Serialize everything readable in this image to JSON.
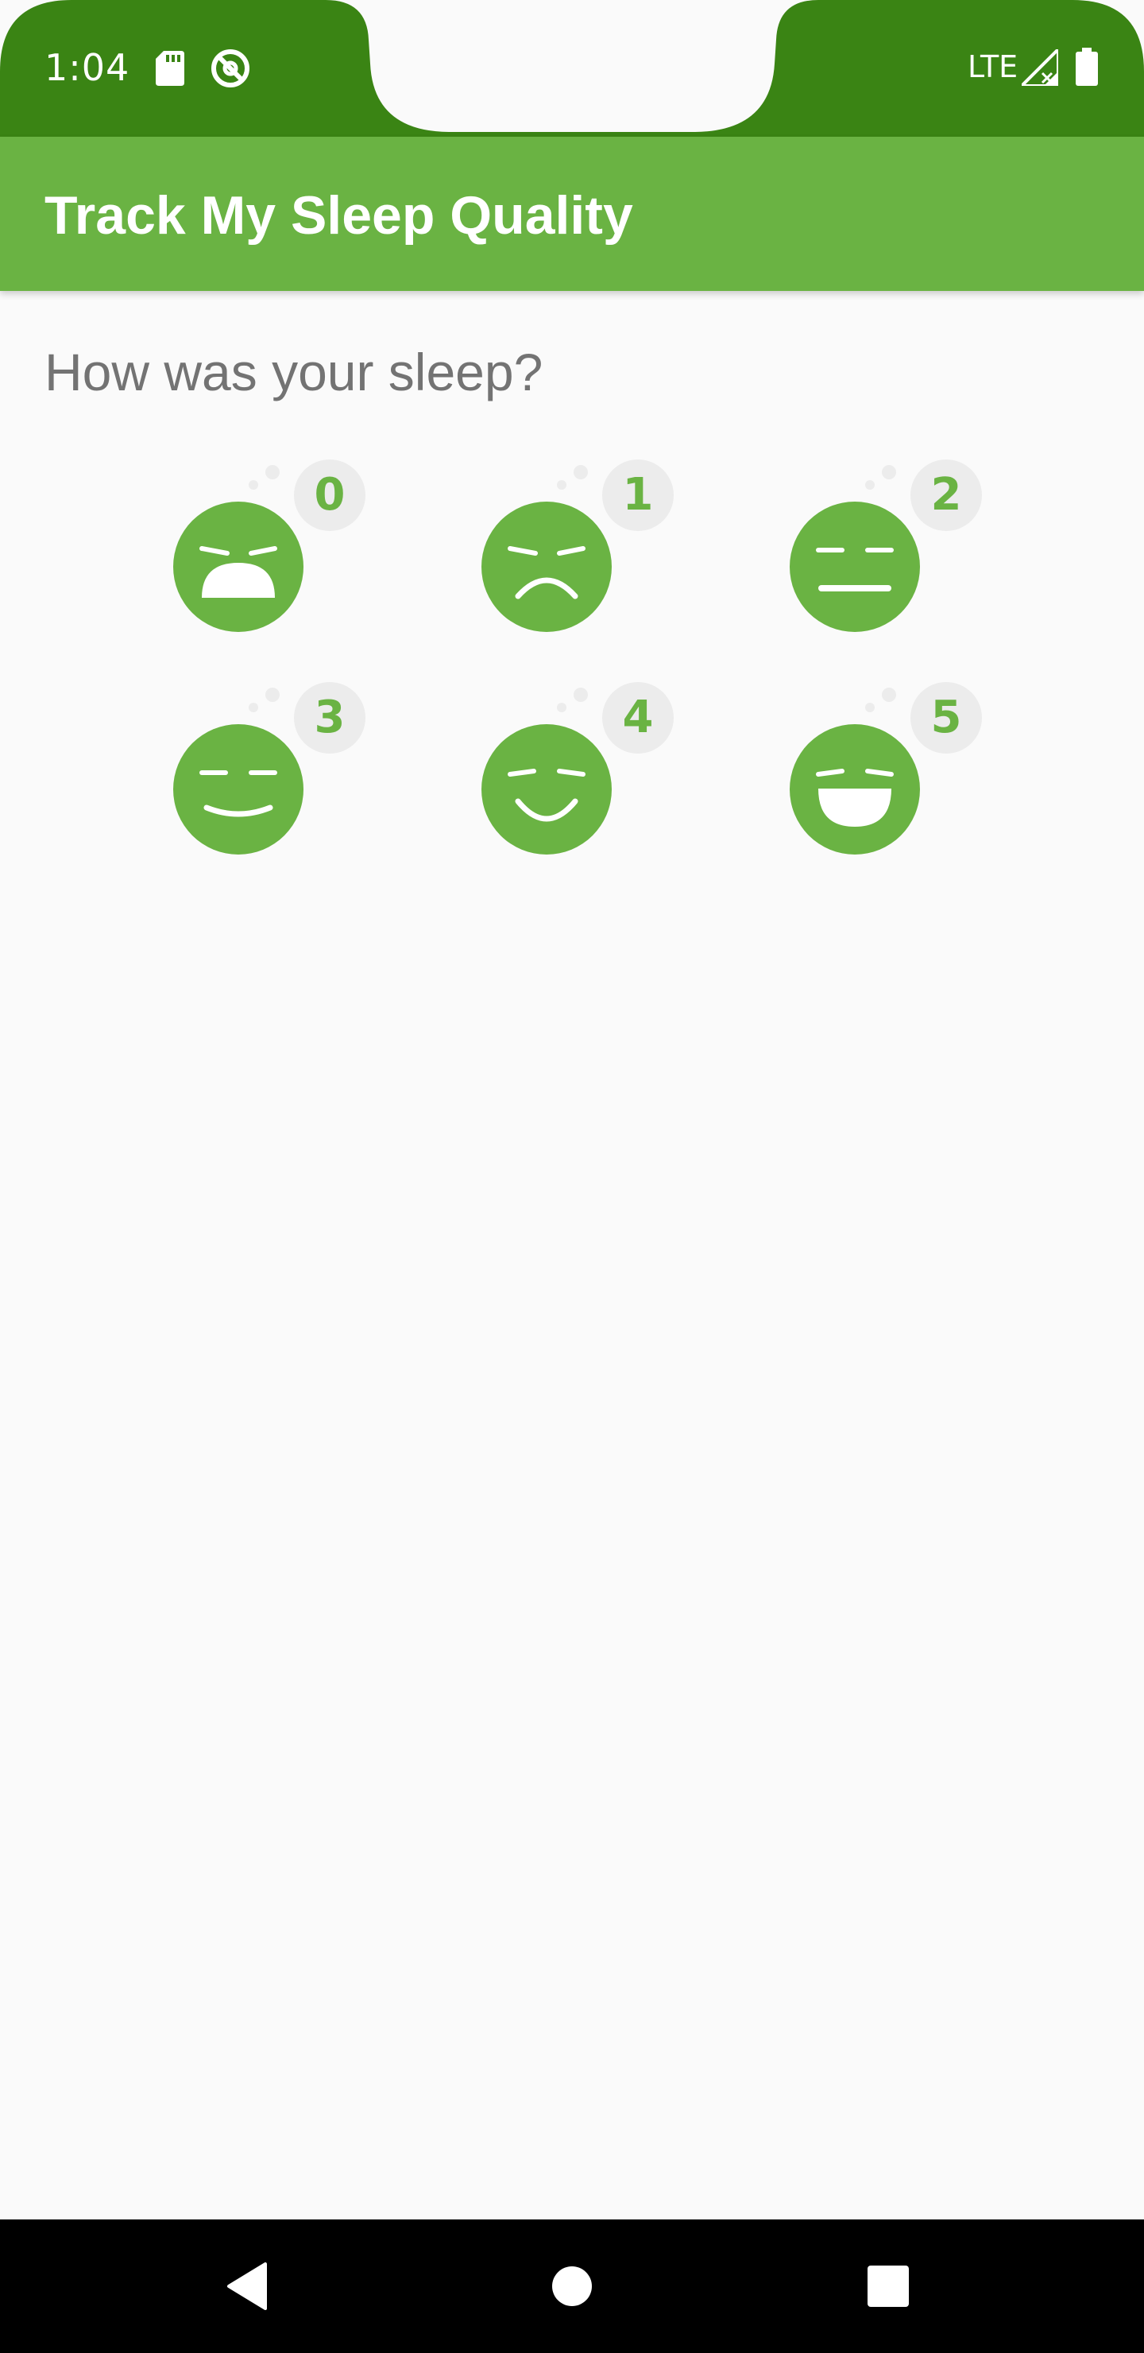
{
  "status_bar": {
    "time": "1:04",
    "network": "LTE",
    "icons": [
      "sd-card-icon",
      "do-not-disturb-icon",
      "signal-icon",
      "battery-icon"
    ],
    "color": "#3a8414"
  },
  "app_bar": {
    "title": "Track My Sleep Quality",
    "color": "#6ab343"
  },
  "content": {
    "prompt": "How was your sleep?",
    "quality_options": [
      {
        "value": "0",
        "icon": "very-bad-sleep-face-icon"
      },
      {
        "value": "1",
        "icon": "bad-sleep-face-icon"
      },
      {
        "value": "2",
        "icon": "neutral-sleep-face-icon"
      },
      {
        "value": "3",
        "icon": "okay-sleep-face-icon"
      },
      {
        "value": "4",
        "icon": "good-sleep-face-icon"
      },
      {
        "value": "5",
        "icon": "excellent-sleep-face-icon"
      }
    ],
    "accent_color": "#6ab343",
    "bubble_color": "#ececec"
  },
  "nav_bar": {
    "buttons": [
      "back-icon",
      "home-icon",
      "recents-icon"
    ]
  }
}
